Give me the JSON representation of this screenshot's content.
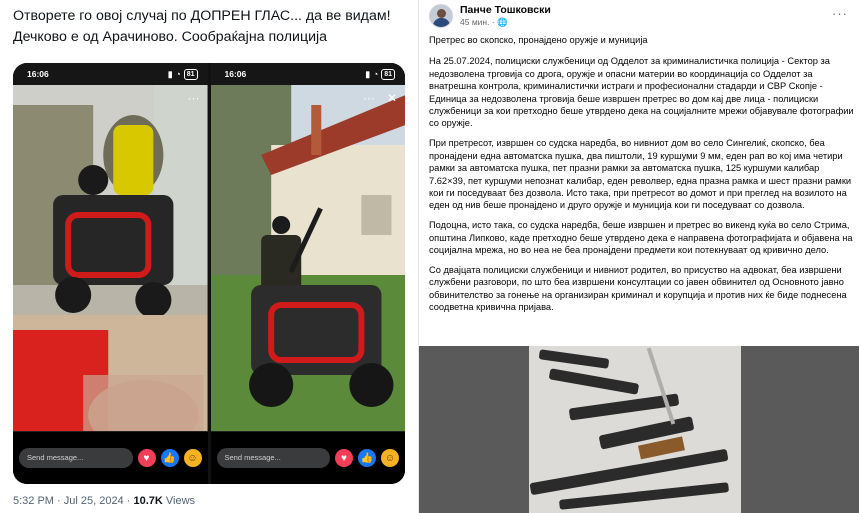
{
  "tweet": {
    "text": "Отворете го овој случај по ДОПРЕН ГЛАС... да ве видам!  Дечково е од Арачиново. Сообраќајна полиција",
    "time": "5:32 PM · Jul 25, 2024 · ",
    "views_count": "10.7K",
    "views_label": " Views"
  },
  "stories": [
    {
      "clock": "16:06",
      "battery": "81",
      "send_placeholder": "Send message..."
    },
    {
      "clock": "16:06",
      "battery": "81",
      "send_placeholder": "Send message..."
    }
  ],
  "icons": {
    "dots": "···",
    "close": "✕",
    "heart": "♥",
    "like": "👍",
    "face": "☺",
    "wifi": "◔",
    "signal": "▮"
  },
  "post": {
    "author": "Панче Тошковски",
    "time": "45 мин. · ",
    "globe": "🌐",
    "more": "···",
    "paragraphs": [
      "Претрес во скопско, пронајдено оружје и муниција",
      "На 25.07.2024, полициски службеници од Одделот за криминалистичка полиција - Сектор за недозволена трговија со дрога, оружје и опасни материи во координација со Одделот за внатрешна контрола, криминалистички истраги и професионални стадарди и СВР Скопје - Единица за недозволена трговија беше извршен претрес во дом кај две лица - полициски службеници за кои претходно беше утврдено дека на социјалните мрежи објавувале фотографии со оружје.",
      "При претресот, извршен со судска наредба, во нивниот дом во село Сингелиќ, скопско, беа пронајдени една автоматска пушка, два пиштоли, 19 куршуми 9 мм, еден рап во кој има четири рамки за автоматска пушка, пет празни рамки за автоматска пушка, 125 куршуми калибар 7.62×39,  пет куршуми непознат калибар, еден револвер, една празна рамка и шест празни рамки кои ги поседуваат без дозвола. Исто така, при претресот во домот и при преглед на возилото на еден од нив беше пронајдено и друго оружје и муниција кои ги поседуваат со дозвола.",
      "Подоцна, исто така, со судска наредба, беше извршен и претрес во викенд куќа во село Стрима, општина Липково, каде претходно беше утврдено дека е направена фотографијата и објавена на социјална мрежа, но во неа не беа пронајдени предмети кои потекнуваат од кривично дело.",
      "Со двајцата полициски службеници и нивниот родител, во присуство на адвокат, беа извршени службени разговори, по што беа извршени консултации со јавен обвинител од Основното јавно обвинителство за гонење на организиран криминал и корупција и против них ќе биде поднесена соодветна кривична пријава."
    ]
  }
}
